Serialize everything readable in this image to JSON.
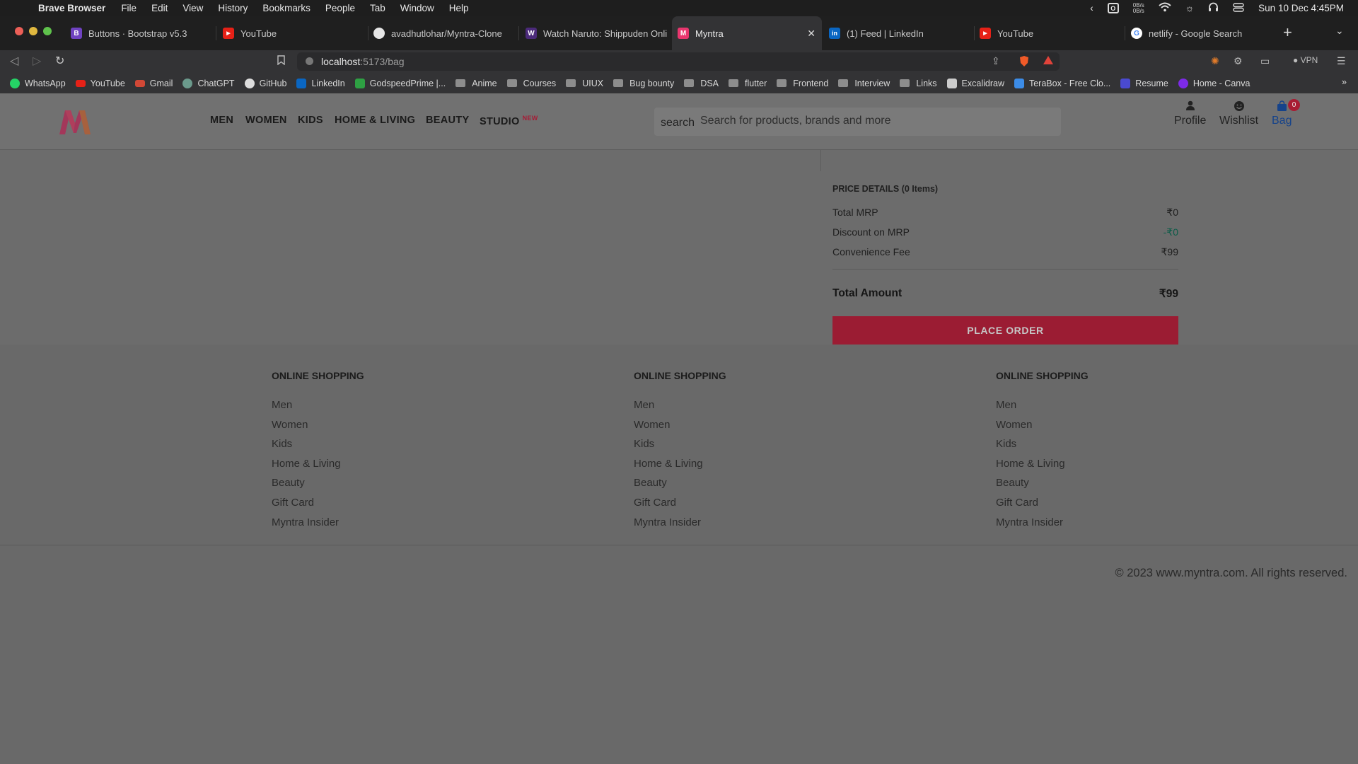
{
  "menubar": {
    "apple": "",
    "app_name": "Brave Browser",
    "menus": [
      "File",
      "Edit",
      "View",
      "History",
      "Bookmarks",
      "People",
      "Tab",
      "Window",
      "Help"
    ],
    "net_up": "0B/s",
    "net_down": "0B/s",
    "clock": "Sun 10 Dec  4:45PM"
  },
  "tabs": [
    {
      "title": "Buttons · Bootstrap v5.3",
      "fav": "B",
      "color": "#6f42c1"
    },
    {
      "title": "YouTube",
      "fav": "▶",
      "color": "#e62117"
    },
    {
      "title": "avadhutlohar/Myntra-Clone",
      "fav": "",
      "color": "#e6e6e6"
    },
    {
      "title": "Watch Naruto: Shippuden Onli",
      "fav": "W",
      "color": "#4b2a7a"
    },
    {
      "title": "Myntra",
      "fav": "M",
      "color": "#e8366e"
    },
    {
      "title": "(1) Feed | LinkedIn",
      "fav": "in",
      "color": "#0a66c2"
    },
    {
      "title": "YouTube",
      "fav": "▶",
      "color": "#e62117"
    },
    {
      "title": "netlify - Google Search",
      "fav": "G",
      "color": "#ffffff"
    }
  ],
  "address": {
    "host": "localhost",
    "path": ":5173/bag"
  },
  "toolbar": {
    "vpn": "VPN"
  },
  "bookmarks": [
    {
      "label": "WhatsApp",
      "type": "site",
      "color": "#25d366"
    },
    {
      "label": "YouTube",
      "type": "site",
      "color": "#e62117"
    },
    {
      "label": "Gmail",
      "type": "site",
      "color": "#d14836"
    },
    {
      "label": "ChatGPT",
      "type": "site",
      "color": "#6b9a8c"
    },
    {
      "label": "GitHub",
      "type": "site",
      "color": "#dddddd"
    },
    {
      "label": "LinkedIn",
      "type": "site",
      "color": "#0a66c2"
    },
    {
      "label": "GodspeedPrime |...",
      "type": "site",
      "color": "#2ea043"
    },
    {
      "label": "Anime",
      "type": "folder"
    },
    {
      "label": "Courses",
      "type": "folder"
    },
    {
      "label": "UIUX",
      "type": "folder"
    },
    {
      "label": "Bug bounty",
      "type": "folder"
    },
    {
      "label": "DSA",
      "type": "folder"
    },
    {
      "label": "flutter",
      "type": "folder"
    },
    {
      "label": "Frontend",
      "type": "folder"
    },
    {
      "label": "Interview",
      "type": "folder"
    },
    {
      "label": "Links",
      "type": "folder"
    },
    {
      "label": "Excalidraw",
      "type": "site",
      "color": "#cccccc"
    },
    {
      "label": "TeraBox - Free Clo...",
      "type": "site",
      "color": "#3c8ce7"
    },
    {
      "label": "Resume",
      "type": "site",
      "color": "#4a4ad0"
    },
    {
      "label": "Home - Canva",
      "type": "site",
      "color": "#7d2ae8"
    }
  ],
  "site": {
    "nav": [
      "MEN",
      "WOMEN",
      "KIDS",
      "HOME & LIVING",
      "BEAUTY",
      "STUDIO"
    ],
    "nav_new_tag": "NEW",
    "search_icon_text": "search",
    "search_placeholder": "Search for products, brands and more",
    "profile_label": "Profile",
    "wishlist_label": "Wishlist",
    "bag_label": "Bag",
    "bag_count": "0"
  },
  "price_details": {
    "title": "PRICE DETAILS (0 Items)",
    "rows": [
      {
        "label": "Total MRP",
        "value": "₹0"
      },
      {
        "label": "Discount on MRP",
        "value": "-₹0"
      },
      {
        "label": "Convenience Fee",
        "value": "₹99"
      }
    ],
    "total_label": "Total Amount",
    "total_value": "₹99",
    "place_order": "PLACE ORDER"
  },
  "footer": {
    "columns": [
      {
        "heading": "ONLINE SHOPPING",
        "links": [
          "Men",
          "Women",
          "Kids",
          "Home & Living",
          "Beauty",
          "Gift Card",
          "Myntra Insider"
        ]
      },
      {
        "heading": "ONLINE SHOPPING",
        "links": [
          "Men",
          "Women",
          "Kids",
          "Home & Living",
          "Beauty",
          "Gift Card",
          "Myntra Insider"
        ]
      },
      {
        "heading": "ONLINE SHOPPING",
        "links": [
          "Men",
          "Women",
          "Kids",
          "Home & Living",
          "Beauty",
          "Gift Card",
          "Myntra Insider"
        ]
      }
    ],
    "copyright": "© 2023 www.myntra.com. All rights reserved."
  }
}
